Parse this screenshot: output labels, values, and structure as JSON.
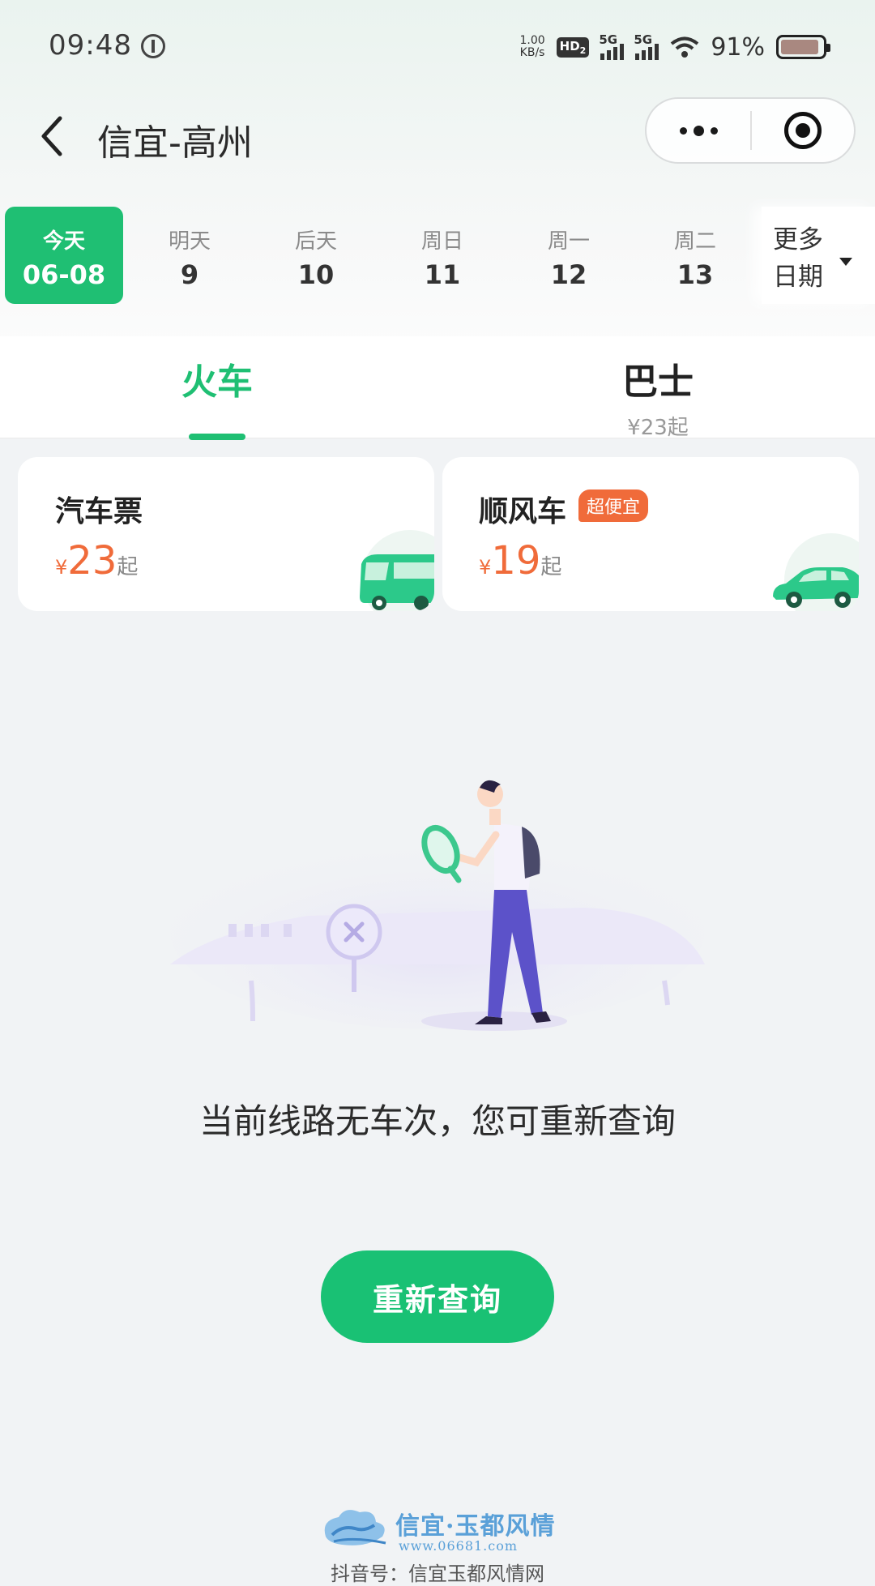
{
  "status_bar": {
    "time": "09:48",
    "net_speed_value": "1.00",
    "net_speed_unit": "KB/s",
    "hd_label": "HD",
    "hd_sub": "2",
    "signal1_label": "5G",
    "signal2_label": "5G",
    "battery_percent": "91%",
    "battery_level": 0.91
  },
  "nav": {
    "title": "信宜-高州"
  },
  "dates": [
    {
      "label": "今天",
      "num": "06-08",
      "active": true
    },
    {
      "label": "明天",
      "num": "9"
    },
    {
      "label": "后天",
      "num": "10"
    },
    {
      "label": "周日",
      "num": "11"
    },
    {
      "label": "周一",
      "num": "12"
    },
    {
      "label": "周二",
      "num": "13"
    }
  ],
  "more_dates_label": "更多日期",
  "tabs": [
    {
      "name": "火车",
      "sub": ""
    },
    {
      "name": "巴士",
      "sub": "¥23起"
    }
  ],
  "cards": [
    {
      "title": "汽车票",
      "badge": "",
      "currency": "¥",
      "price": "23",
      "suffix": "起"
    },
    {
      "title": "顺风车",
      "badge": "超便宜",
      "currency": "¥",
      "price": "19",
      "suffix": "起"
    }
  ],
  "empty_message": "当前线路无车次，您可重新查询",
  "retry_label": "重新查询",
  "watermark": {
    "title": "信宜·玉都风情",
    "url": "www.06681.com",
    "line": "抖音号：信宜玉都风情网"
  },
  "colors": {
    "accent": "#1fbf73",
    "price": "#f06b3a",
    "background": "#f1f3f5"
  },
  "icons": [
    "back-arrow-icon",
    "more-dots-icon",
    "close-target-icon",
    "dropdown-caret-icon",
    "bus-icon",
    "car-icon"
  ]
}
